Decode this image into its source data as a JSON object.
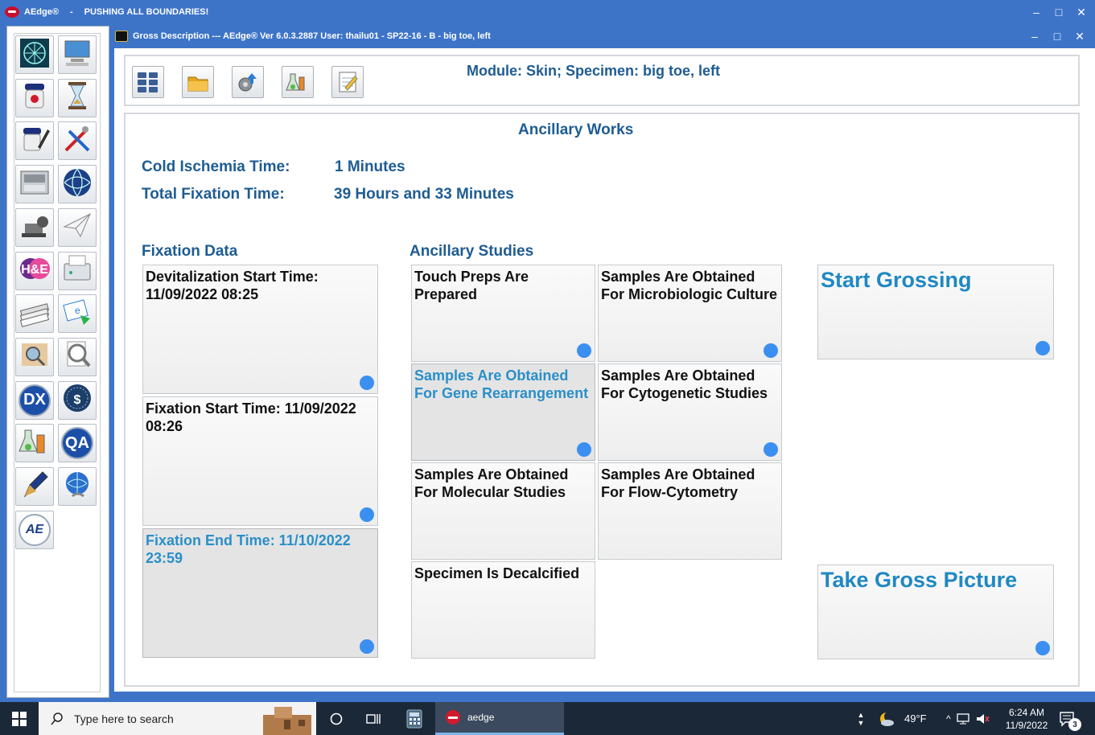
{
  "outer_window": {
    "app_name": "AEdge®",
    "separator": "-",
    "motto": "PUSHING ALL BOUNDARIES!"
  },
  "inner_window": {
    "title": "Gross Description --- AEdge®  Ver 6.0.3.2887  User: thailu01 - SP22-16 - B - big toe, left"
  },
  "launcher": {
    "items": [
      {
        "name": "network-icon"
      },
      {
        "name": "computer-icon"
      },
      {
        "name": "specimen-jar-icon"
      },
      {
        "name": "hourglass-icon"
      },
      {
        "name": "jar-pen-icon"
      },
      {
        "name": "tools-icon"
      },
      {
        "name": "processor-icon"
      },
      {
        "name": "globe-sphere-icon"
      },
      {
        "name": "microtome-icon"
      },
      {
        "name": "paper-plane-icon"
      },
      {
        "name": "he-stain-icon"
      },
      {
        "name": "fax-icon"
      },
      {
        "name": "slides-icon"
      },
      {
        "name": "e-send-icon"
      },
      {
        "name": "magnifier-sample-icon"
      },
      {
        "name": "magnifier-document-icon"
      },
      {
        "name": "dx-icon",
        "text": "DX"
      },
      {
        "name": "billing-icon",
        "text": "$"
      },
      {
        "name": "lab-flasks-icon"
      },
      {
        "name": "qa-icon",
        "text": "QA"
      },
      {
        "name": "fountain-pen-icon"
      },
      {
        "name": "web-globe-icon"
      },
      {
        "name": "aedge-logo-icon",
        "text": "AE"
      }
    ]
  },
  "toolbar": {
    "module_title": "Module: Skin; Specimen: big toe, left"
  },
  "main": {
    "title": "Ancillary Works",
    "cold_ischemia_label": "Cold Ischemia Time:",
    "cold_ischemia_value": "1 Minutes",
    "total_fixation_label": "Total Fixation Time:",
    "total_fixation_value": "39 Hours  and 33 Minutes",
    "fixation_heading": "Fixation Data",
    "ancillary_heading": "Ancillary Studies",
    "fixation_tiles": [
      "Devitalization Start Time: 11/09/2022 08:25",
      "Fixation Start Time: 11/09/2022 08:26",
      "Fixation End Time: 11/10/2022 23:59"
    ],
    "ancillary_tiles": [
      "Touch Preps Are Prepared",
      "Samples Are Obtained For Microbiologic Culture",
      "Samples Are Obtained For Gene Rearrangement",
      "Samples Are Obtained For Cytogenetic Studies",
      "Samples Are Obtained For Molecular Studies",
      "Samples Are Obtained For Flow-Cytometry",
      "Specimen Is Decalcified"
    ],
    "start_grossing": "Start Grossing",
    "take_picture": "Take Gross Picture"
  },
  "taskbar": {
    "search_placeholder": "Type here to search",
    "app_label": "aedge",
    "temperature": "49°F",
    "time": "6:24 AM",
    "date": "11/9/2022",
    "notification_count": "3"
  },
  "colors": {
    "title_blue": "#1e5c93",
    "accent_blue": "#2a8fc9",
    "dot_blue": "#3b8ff0",
    "frame_blue": "#3d74c8"
  }
}
